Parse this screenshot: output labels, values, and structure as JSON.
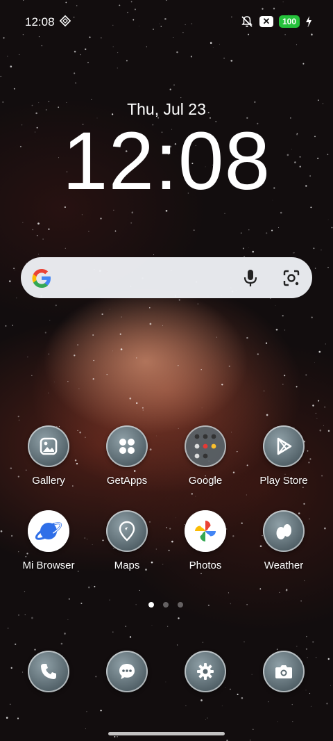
{
  "status_bar": {
    "time": "12:08",
    "battery": "100",
    "accent_battery": "#25c23b"
  },
  "lockscreen_clock": {
    "date": "Thu, Jul 23",
    "time": "12:08"
  },
  "search_bar": {
    "icons": [
      "google-logo",
      "mic-icon",
      "lens-icon"
    ]
  },
  "apps": [
    {
      "label": "Gallery",
      "icon": "gallery-icon"
    },
    {
      "label": "GetApps",
      "icon": "getapps-icon"
    },
    {
      "label": "Google",
      "icon": "folder-icon"
    },
    {
      "label": "Play Store",
      "icon": "play-store-icon"
    },
    {
      "label": "Mi Browser",
      "icon": "browser-icon"
    },
    {
      "label": "Maps",
      "icon": "maps-icon"
    },
    {
      "label": "Photos",
      "icon": "photos-icon"
    },
    {
      "label": "Weather",
      "icon": "weather-icon"
    }
  ],
  "page_indicator": {
    "pages": 3,
    "active": 1
  },
  "dock": [
    {
      "icon": "phone-icon"
    },
    {
      "icon": "messages-icon"
    },
    {
      "icon": "settings-icon"
    },
    {
      "icon": "camera-icon"
    }
  ]
}
